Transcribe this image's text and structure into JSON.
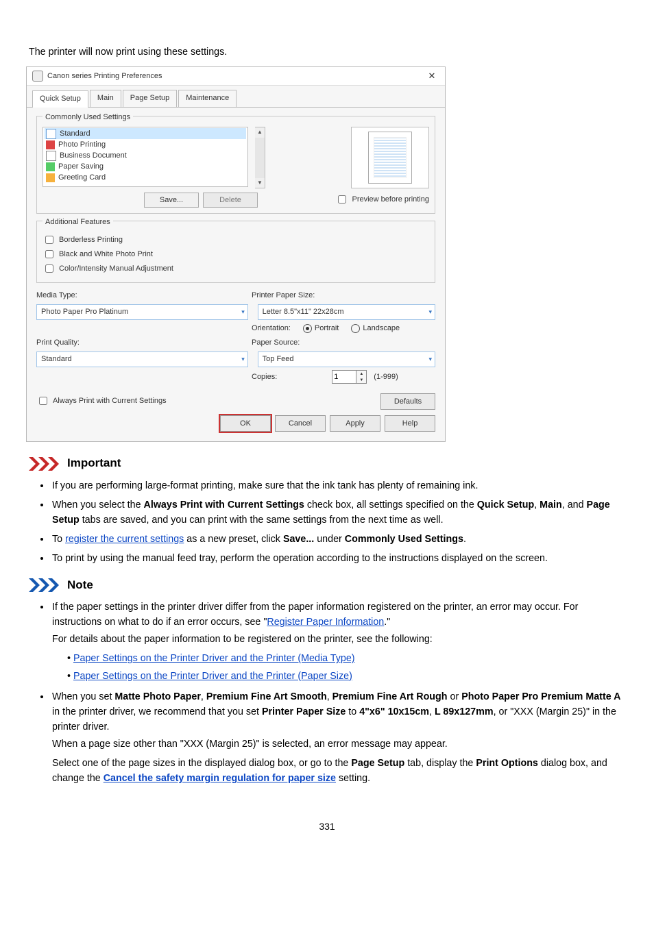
{
  "intro": "The printer will now print using these settings.",
  "dialog": {
    "window_title": "Canon           series Printing Preferences",
    "close": "✕",
    "tabs": [
      "Quick Setup",
      "Main",
      "Page Setup",
      "Maintenance"
    ],
    "commonly_used": {
      "legend": "Commonly Used Settings",
      "items": [
        "Standard",
        "Photo Printing",
        "Business Document",
        "Paper Saving",
        "Greeting Card"
      ],
      "save_btn": "Save...",
      "delete_btn": "Delete",
      "preview_chk": "Preview before printing"
    },
    "additional": {
      "legend": "Additional Features",
      "items": [
        "Borderless Printing",
        "Black and White Photo Print",
        "Color/Intensity Manual Adjustment"
      ]
    },
    "media_type_label": "Media Type:",
    "media_type_value": "Photo Paper Pro Platinum",
    "paper_size_label": "Printer Paper Size:",
    "paper_size_value": "Letter 8.5\"x11\" 22x28cm",
    "orientation_label": "Orientation:",
    "orientation_portrait": "Portrait",
    "orientation_landscape": "Landscape",
    "quality_label": "Print Quality:",
    "quality_value": "Standard",
    "paper_source_label": "Paper Source:",
    "paper_source_value": "Top Feed",
    "copies_label": "Copies:",
    "copies_value": "1",
    "copies_range": "(1-999)",
    "always_print_chk": "Always Print with Current Settings",
    "defaults_btn": "Defaults",
    "ok": "OK",
    "cancel": "Cancel",
    "apply": "Apply",
    "help": "Help"
  },
  "important": {
    "title": "Important",
    "b1": "If you are performing large-format printing, make sure that the ink tank has plenty of remaining ink.",
    "b2_a": "When you select the ",
    "b2_bold": "Always Print with Current Settings",
    "b2_b": " check box, all settings specified on the ",
    "b2_qs": "Quick Setup",
    "b2_c": ", ",
    "b2_main": "Main",
    "b2_d": ", and ",
    "b2_ps": "Page Setup",
    "b2_e": " tabs are saved, and you can print with the same settings from the next time as well.",
    "b3_a": "To ",
    "b3_link": "register the current settings",
    "b3_b": " as a new preset, click ",
    "b3_save": "Save...",
    "b3_c": " under ",
    "b3_cus": "Commonly Used Settings",
    "b3_d": ".",
    "b4": "To print by using the manual feed tray, perform the operation according to the instructions displayed on the screen."
  },
  "note": {
    "title": "Note",
    "b1_a": "If the paper settings in the printer driver differ from the paper information registered on the printer, an error may occur. For instructions on what to do if an error occurs, see \"",
    "b1_link": "Register Paper Information",
    "b1_b": ".\"",
    "b1_c": "For details about the paper information to be registered on the printer, see the following:",
    "sub1": "Paper Settings on the Printer Driver and the Printer (Media Type)",
    "sub2": "Paper Settings on the Printer Driver and the Printer (Paper Size)",
    "b2_a": "When you set ",
    "b2_m1": "Matte Photo Paper",
    "b2_c1": ", ",
    "b2_m2": "Premium Fine Art Smooth",
    "b2_c2": ", ",
    "b2_m3": "Premium Fine Art Rough",
    "b2_c3": " or ",
    "b2_m4": "Photo Paper Pro Premium Matte A",
    "b2_b": " in the printer driver, we recommend that you set ",
    "b2_pps": "Printer Paper Size",
    "b2_c": " to ",
    "b2_s1": "4\"x6\" 10x15cm",
    "b2_c4": ", ",
    "b2_s2": "L 89x127mm",
    "b2_d": ", or \"XXX (Margin 25)\" in the printer driver.",
    "b2_e": "When a page size other than \"XXX (Margin 25)\" is selected, an error message may appear.",
    "b2_f": "Select one of the page sizes in the displayed dialog box, or go to the ",
    "b2_ps": "Page Setup",
    "b2_g": " tab, display the ",
    "b2_po": "Print Options",
    "b2_h": " dialog box, and change the ",
    "b2_link": "Cancel the safety margin regulation for paper size",
    "b2_i": " setting."
  },
  "page_number": "331"
}
